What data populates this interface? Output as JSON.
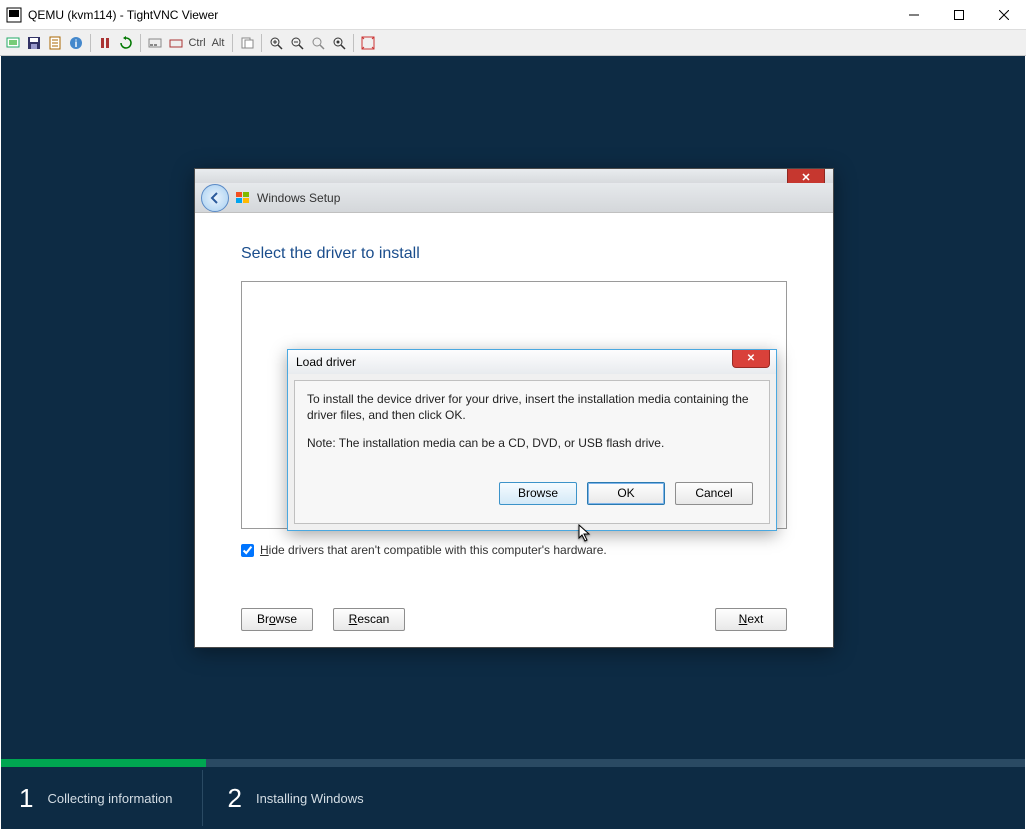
{
  "vnc": {
    "title": "QEMU (kvm114) - TightVNC Viewer",
    "ctrl_label": "Ctrl",
    "alt_label": "Alt"
  },
  "stages": {
    "num1": "1",
    "label1": "Collecting information",
    "num2": "2",
    "label2": "Installing Windows"
  },
  "wizard": {
    "title": "Windows Setup",
    "heading": "Select the driver to install",
    "checkbox_label_pre": "H",
    "checkbox_label_rest": "ide drivers that aren't compatible with this computer's hardware.",
    "browse_pre": "Br",
    "browse_u": "o",
    "browse_post": "wse",
    "rescan_u": "R",
    "rescan_post": "escan",
    "next_u": "N",
    "next_post": "ext"
  },
  "modal": {
    "title": "Load driver",
    "p1": "To install the device driver for your drive, insert the installation media containing the driver files, and then click OK.",
    "p2": "Note: The installation media can be a CD, DVD, or USB flash drive.",
    "browse": "Browse",
    "ok": "OK",
    "cancel": "Cancel"
  }
}
